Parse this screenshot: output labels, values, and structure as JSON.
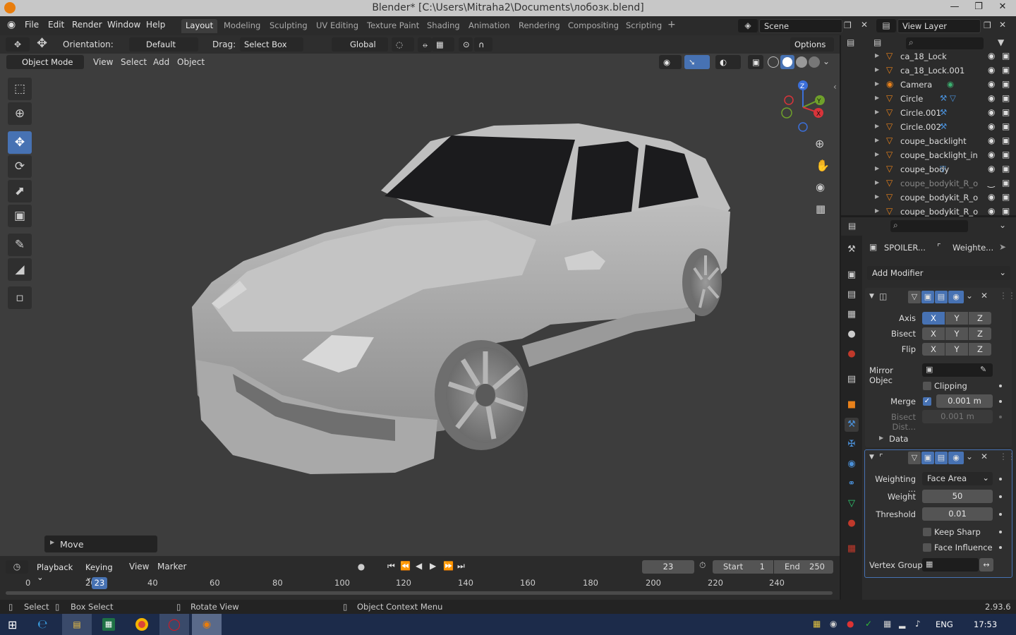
{
  "window": {
    "title": "Blender* [C:\\Users\\Mitraha2\\Documents\\лобозк.blend]"
  },
  "menu": {
    "file": "File",
    "edit": "Edit",
    "render": "Render",
    "window": "Window",
    "help": "Help"
  },
  "workspaces": [
    "Layout",
    "Modeling",
    "Sculpting",
    "UV Editing",
    "Texture Paint",
    "Shading",
    "Animation",
    "Rendering",
    "Compositing",
    "Scripting"
  ],
  "scene": {
    "name": "Scene",
    "view_layer": "View Layer"
  },
  "header": {
    "orientation_label": "Orientation:",
    "orientation_value": "Default",
    "drag_label": "Drag:",
    "drag_value": "Select Box",
    "transform": "Global",
    "options": "Options"
  },
  "viewport_menu": {
    "mode": "Object Mode",
    "view": "View",
    "select": "Select",
    "add": "Add",
    "object": "Object"
  },
  "operator_panel": {
    "label": "Move"
  },
  "outliner": {
    "items": [
      {
        "name": "ca_18_Lock",
        "dim": false,
        "extra": ""
      },
      {
        "name": "ca_18_Lock.001",
        "dim": false,
        "extra": ""
      },
      {
        "name": "Camera",
        "dim": false,
        "extra": "camera-data-icon"
      },
      {
        "name": "Circle",
        "dim": false,
        "extra": "wrench-mesh-icon"
      },
      {
        "name": "Circle.001",
        "dim": false,
        "extra": "wrench-icon"
      },
      {
        "name": "Circle.002",
        "dim": false,
        "extra": "wrench-icon"
      },
      {
        "name": "coupe_backlight",
        "dim": false,
        "extra": ""
      },
      {
        "name": "coupe_backlight_in",
        "dim": false,
        "extra": ""
      },
      {
        "name": "coupe_body",
        "dim": false,
        "extra": "mesh-icon"
      },
      {
        "name": "coupe_bodykit_R_o",
        "dim": true,
        "extra": ""
      },
      {
        "name": "coupe_bodykit_R_o",
        "dim": false,
        "extra": ""
      },
      {
        "name": "coupe_bodykit_R_o",
        "dim": false,
        "extra": ""
      }
    ]
  },
  "properties": {
    "object_name": "SPOILER...",
    "modifier_name": "Weighte...",
    "add_modifier": "Add Modifier",
    "mirror": {
      "axis_label": "Axis",
      "bisect_label": "Bisect",
      "flip_label": "Flip",
      "x": "X",
      "y": "Y",
      "z": "Z",
      "mirror_object_label": "Mirror Objec",
      "clipping_label": "Clipping",
      "merge_label": "Merge",
      "merge_value": "0.001 m",
      "bisect_dist_label": "Bisect Dist...",
      "bisect_dist_value": "0.001 m",
      "data_label": "Data"
    },
    "weighted_normal": {
      "weighting_label": "Weighting ...",
      "weighting_value": "Face Area",
      "weight_label": "Weight",
      "weight_value": "50",
      "threshold_label": "Threshold",
      "threshold_value": "0.01",
      "keep_sharp_label": "Keep Sharp",
      "face_influence_label": "Face Influence",
      "vertex_group_label": "Vertex Group"
    }
  },
  "timeline": {
    "playback": "Playback",
    "keying": "Keying",
    "view": "View",
    "marker": "Marker",
    "current_frame": "23",
    "start_label": "Start",
    "start_value": "1",
    "end_label": "End",
    "end_value": "250",
    "ticks": [
      "0",
      "2",
      "20",
      "40",
      "60",
      "80",
      "100",
      "120",
      "140",
      "160",
      "180",
      "200",
      "220",
      "240"
    ],
    "cursor": "23"
  },
  "status": {
    "select": "Select",
    "box_select": "Box Select",
    "rotate_view": "Rotate View",
    "context_menu": "Object Context Menu",
    "version": "2.93.6"
  },
  "taskbar": {
    "lang": "ENG",
    "time": "17:53"
  },
  "gizmo": {
    "x": "X",
    "y": "Y",
    "z": "Z"
  },
  "colors": {
    "accent": "#4772b3",
    "viewport_bg": "#3d3d3d",
    "panel_bg": "#2b2b2b"
  }
}
